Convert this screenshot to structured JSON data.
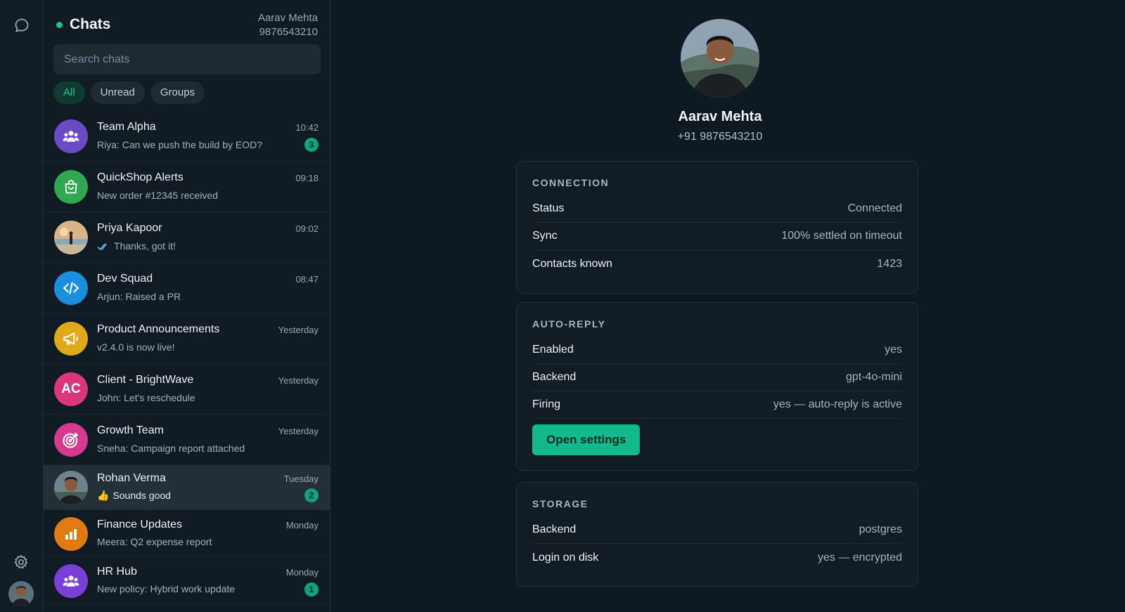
{
  "app": {
    "title": "Chats"
  },
  "account": {
    "name": "Aarav Mehta",
    "number": "9876543210"
  },
  "search": {
    "placeholder": "Search chats"
  },
  "filters": [
    {
      "label": "All",
      "active": true
    },
    {
      "label": "Unread",
      "active": false
    },
    {
      "label": "Groups",
      "active": false
    }
  ],
  "chats": [
    {
      "name": "Team Alpha",
      "preview": "Riya: Can we push the build by EOD?",
      "time": "10:42",
      "unread": "3",
      "avatar_icon": "group-icon",
      "avatar_color": "#6a4bc4"
    },
    {
      "name": "QuickShop Alerts",
      "preview": "New order #12345 received",
      "time": "09:18",
      "unread": "",
      "avatar_icon": "shopping-bag-icon",
      "avatar_color": "#2fa84f"
    },
    {
      "name": "Priya Kapoor",
      "preview": "Thanks, got it!",
      "time": "09:02",
      "unread": "",
      "avatar_icon": "photo-avatar",
      "avatar_color": "#c9a27a",
      "read_receipt": "double-check-icon"
    },
    {
      "name": "Dev Squad",
      "preview": "Arjun: Raised a PR",
      "time": "08:47",
      "unread": "",
      "avatar_icon": "code-icon",
      "avatar_color": "#1a8fe0"
    },
    {
      "name": "Product Announcements",
      "preview": "v2.4.0 is now live!",
      "time": "Yesterday",
      "unread": "",
      "avatar_icon": "megaphone-icon",
      "avatar_color": "#e0a91c"
    },
    {
      "name": "Client - BrightWave",
      "preview": "John: Let's reschedule",
      "time": "Yesterday",
      "unread": "",
      "avatar_icon": "initials",
      "avatar_initials": "AC",
      "avatar_color": "#d9397a"
    },
    {
      "name": "Growth Team",
      "preview": "Sneha: Campaign report attached",
      "time": "Yesterday",
      "unread": "",
      "avatar_icon": "target-icon",
      "avatar_color": "#d43a8e"
    },
    {
      "name": "Rohan Verma",
      "preview": "Sounds good",
      "time": "Tuesday",
      "unread": "2",
      "avatar_icon": "photo-avatar",
      "avatar_color": "#5a6670",
      "emoji": "👍",
      "selected": true
    },
    {
      "name": "Finance Updates",
      "preview": "Meera: Q2 expense report",
      "time": "Monday",
      "unread": "",
      "avatar_icon": "bar-chart-icon",
      "avatar_color": "#e07a12"
    },
    {
      "name": "HR Hub",
      "preview": "New policy: Hybrid work update",
      "time": "Monday",
      "unread": "1",
      "avatar_icon": "group-icon",
      "avatar_color": "#7a3fd6"
    }
  ],
  "profile": {
    "name": "Aarav Mehta",
    "phone": "+91 9876543210"
  },
  "cards": {
    "connection": {
      "title": "CONNECTION",
      "rows": [
        {
          "k": "Status",
          "v": "Connected"
        },
        {
          "k": "Sync",
          "v": "100% settled on timeout"
        },
        {
          "k": "Contacts known",
          "v": "1423"
        }
      ]
    },
    "autoreply": {
      "title": "AUTO-REPLY",
      "rows": [
        {
          "k": "Enabled",
          "v": "yes"
        },
        {
          "k": "Backend",
          "v": "gpt-4o-mini"
        },
        {
          "k": "Firing",
          "v": "yes — auto-reply is active"
        }
      ],
      "button": "Open settings"
    },
    "storage": {
      "title": "STORAGE",
      "rows": [
        {
          "k": "Backend",
          "v": "postgres"
        },
        {
          "k": "Login on disk",
          "v": "yes — encrypted"
        }
      ]
    }
  },
  "colors": {
    "accent": "#12b98a",
    "background": "#0f1923",
    "panel": "#111b24"
  }
}
